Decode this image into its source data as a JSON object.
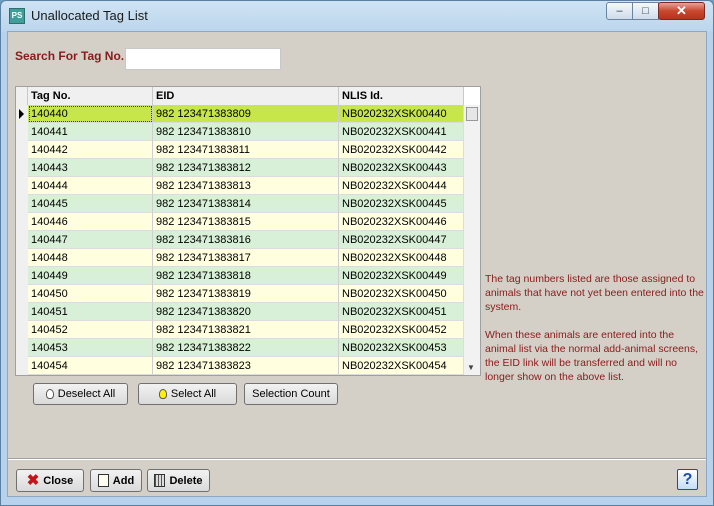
{
  "window": {
    "title": "Unallocated Tag List",
    "icon": "app-icon",
    "min_glyph": "–",
    "max_glyph": "□",
    "close_glyph": "✕"
  },
  "search": {
    "label": "Search For Tag No.",
    "value": "",
    "placeholder": ""
  },
  "grid": {
    "columns": [
      "Tag No.",
      "EID",
      "NLIS Id."
    ],
    "selected_index": 0,
    "rows": [
      [
        "140440",
        "982 123471383809",
        "NB020232XSK00440"
      ],
      [
        "140441",
        "982 123471383810",
        "NB020232XSK00441"
      ],
      [
        "140442",
        "982 123471383811",
        "NB020232XSK00442"
      ],
      [
        "140443",
        "982 123471383812",
        "NB020232XSK00443"
      ],
      [
        "140444",
        "982 123471383813",
        "NB020232XSK00444"
      ],
      [
        "140445",
        "982 123471383814",
        "NB020232XSK00445"
      ],
      [
        "140446",
        "982 123471383815",
        "NB020232XSK00446"
      ],
      [
        "140447",
        "982 123471383816",
        "NB020232XSK00447"
      ],
      [
        "140448",
        "982 123471383817",
        "NB020232XSK00448"
      ],
      [
        "140449",
        "982 123471383818",
        "NB020232XSK00449"
      ],
      [
        "140450",
        "982 123471383819",
        "NB020232XSK00450"
      ],
      [
        "140451",
        "982 123471383820",
        "NB020232XSK00451"
      ],
      [
        "140452",
        "982 123471383821",
        "NB020232XSK00452"
      ],
      [
        "140453",
        "982 123471383822",
        "NB020232XSK00453"
      ],
      [
        "140454",
        "982 123471383823",
        "NB020232XSK00454"
      ]
    ]
  },
  "selection_buttons": {
    "deselect_all": "Deselect All",
    "select_all": "Select All",
    "selection_count": "Selection Count"
  },
  "info": {
    "paragraph1": "The tag numbers listed are those assigned to animals that have not yet been entered into the system.",
    "paragraph2": "When these animals are entered into the animal list via the normal add-animal screens, the EID link will be transferred and will no longer show on the above list."
  },
  "footer": {
    "close": "Close",
    "add": "Add",
    "delete": "Delete",
    "help": "?"
  },
  "colors": {
    "label_red": "#8b1a1a",
    "row_odd": "#ffffe0",
    "row_even": "#d8f0d8",
    "row_selected": "#c6e64a"
  }
}
